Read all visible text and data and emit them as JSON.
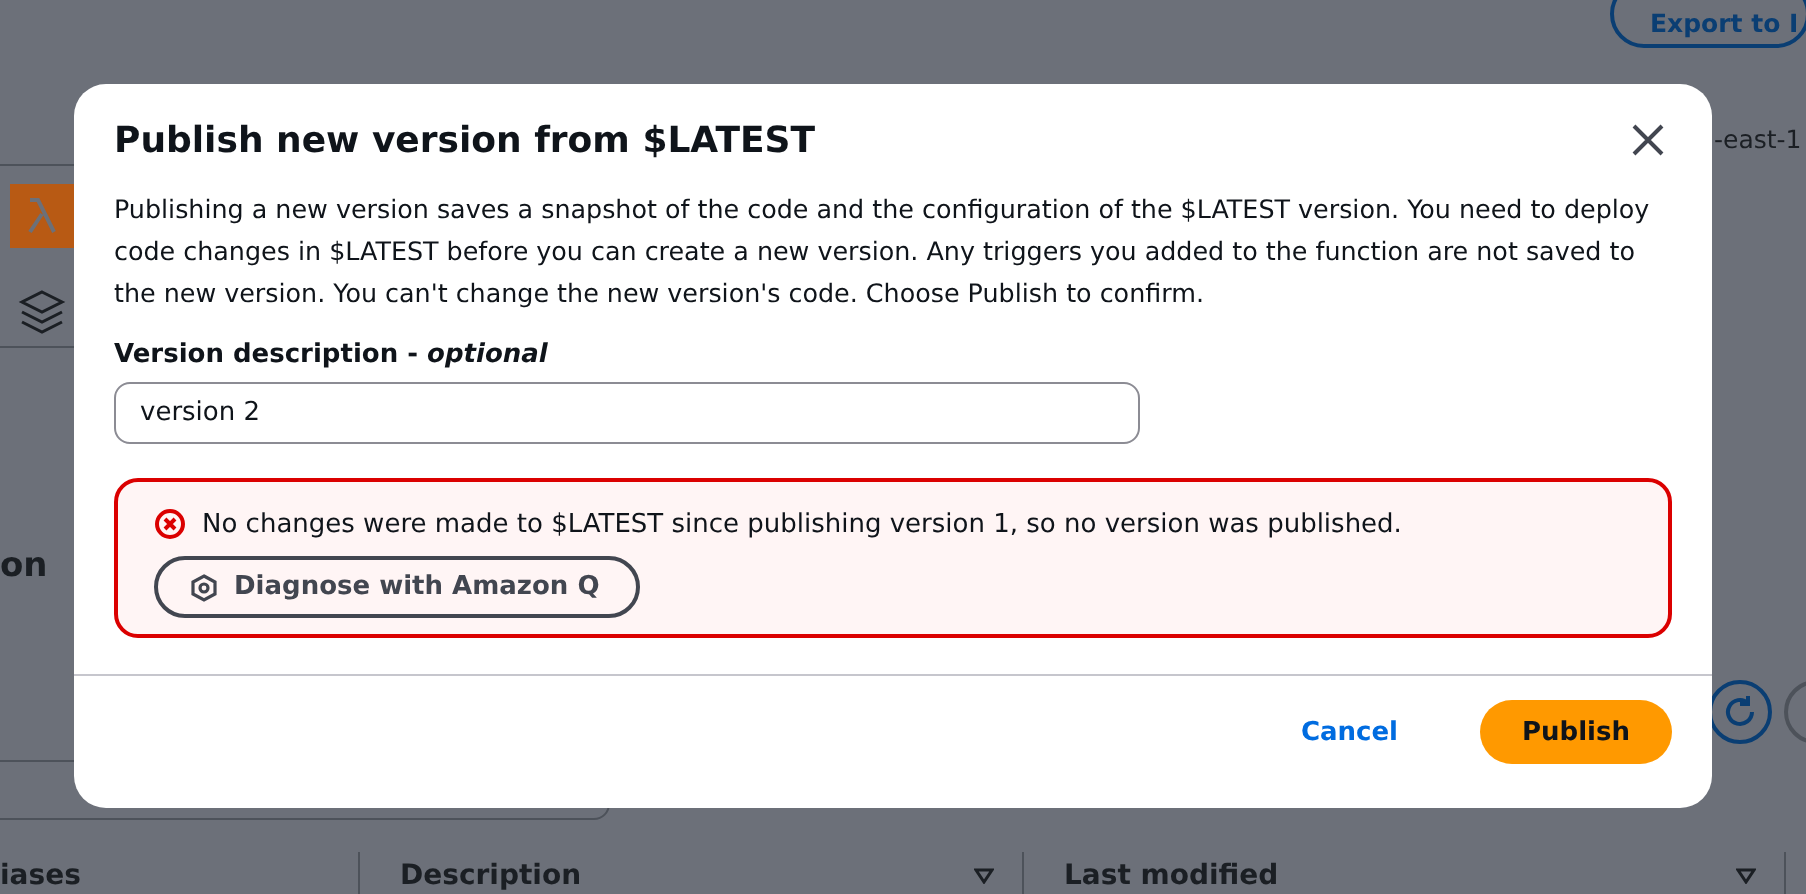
{
  "background": {
    "export_button": "Export to I",
    "region_text": "-east-1",
    "section_heading": "on",
    "table_columns": [
      {
        "label": "iases",
        "sortable": false
      },
      {
        "label": "Description",
        "sortable": true
      },
      {
        "label": "Last modified",
        "sortable": true
      }
    ]
  },
  "dialog": {
    "title": "Publish new version from $LATEST",
    "description": "Publishing a new version saves a snapshot of the code and the configuration of the $LATEST version. You need to deploy code changes in $LATEST before you can create a new version. Any triggers you added to the function are not saved to the new version. You can't change the new version's code. Choose Publish to confirm.",
    "field": {
      "label": "Version description - *optional*",
      "value": "version 2"
    },
    "error": {
      "message": "No changes were made to $LATEST since publishing version 1, so no version was published.",
      "button": "Diagnose with Amazon Q"
    },
    "buttons": [
      {
        "label": "Cancel",
        "kind": "link"
      },
      {
        "label": "Publish",
        "kind": "primary"
      }
    ]
  }
}
